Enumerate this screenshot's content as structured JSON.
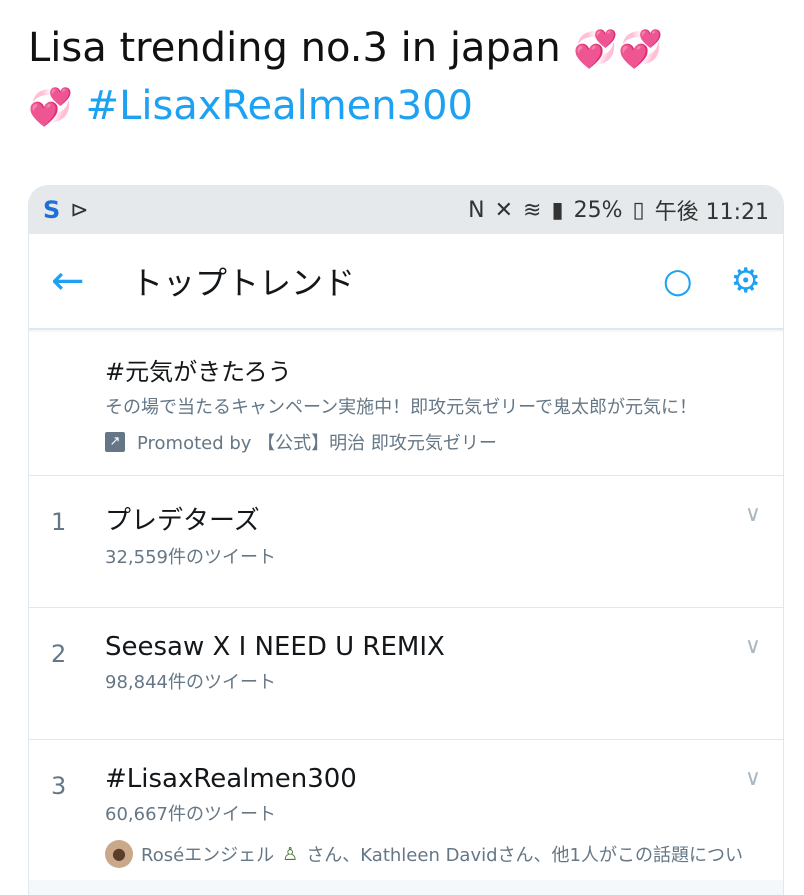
{
  "caption": {
    "line1": "Lisa trending no.3 in japan",
    "line2_hashtag": "#LisaxRealmen300",
    "heart": "💞"
  },
  "status_bar": {
    "left_icons": [
      "s-icon",
      "send-icon"
    ],
    "battery_percent": "25%",
    "time": "午後 11:21"
  },
  "app_bar": {
    "title": "トップトレンド"
  },
  "promoted": {
    "tag": "#元気がきたろう",
    "description": "その場で当たるキャンペーン実施中！即攻元気ゼリーで鬼太郎が元気に！",
    "promoted_by": "Promoted by 【公式】明治 即攻元気ゼリー"
  },
  "trends": [
    {
      "rank": "1",
      "name": "プレデターズ",
      "count": "32,559件のツイート"
    },
    {
      "rank": "2",
      "name": "Seesaw X I NEED U REMIX",
      "count": "98,844件のツイート"
    },
    {
      "rank": "3",
      "name": "#LisaxRealmen300",
      "count": "60,667件のツイート",
      "context": "Roséエンジェル",
      "context_rest": "さん、Kathleen Davidさん、他1人がこの話題につい"
    }
  ],
  "colors": {
    "accent": "#1da1f2",
    "muted": "#657786"
  }
}
